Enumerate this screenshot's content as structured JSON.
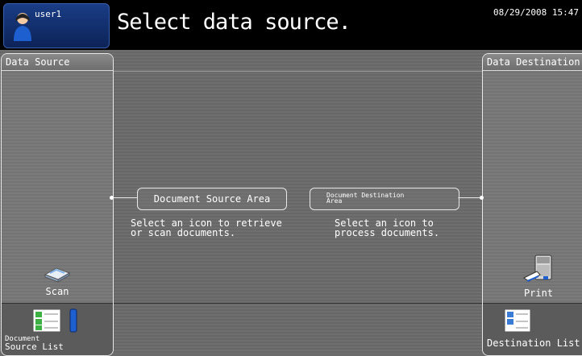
{
  "header": {
    "user": "user1",
    "title": "Select data source.",
    "datetime": "08/29/2008 15:47"
  },
  "source_panel": {
    "header": "Data Source",
    "scan_label": "Scan",
    "list_label_line1": "Document",
    "list_label_line2": "Source List"
  },
  "dest_panel": {
    "header": "Data Destination",
    "print_label": "Print",
    "list_label": "Destination List"
  },
  "center": {
    "source_area_label": "Document Source Area",
    "source_area_desc_line1": "Select an icon to retrieve",
    "source_area_desc_line2": "or scan documents.",
    "dest_area_label_line1": "Document Destination",
    "dest_area_label_line2": "Area",
    "dest_area_desc_line1": "Select an icon to",
    "dest_area_desc_line2": "process documents."
  },
  "colors": {
    "header_bg": "#000000",
    "user_box": "#1a3d86",
    "background": "#6a6a6a"
  }
}
